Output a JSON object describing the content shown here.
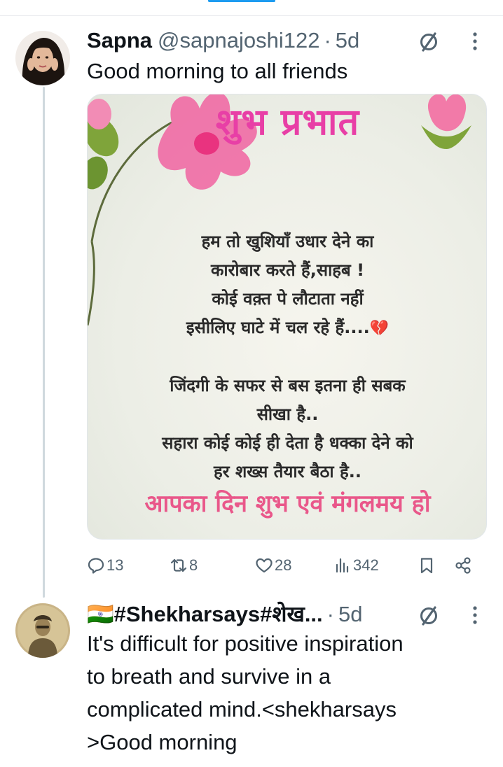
{
  "tweets": [
    {
      "display_name": "Sapna",
      "handle": "@sapnajoshi122",
      "separator": "·",
      "time": "5d",
      "text": "Good morning to all friends",
      "media": {
        "title": "शुभ प्रभात",
        "poem_stanza_1": [
          "हम तो खुशियाँ उधार देने का",
          "कारोबार करते हैं,साहब !",
          "कोई वक़्त पे लौटाता नहीं",
          "इसीलिए घाटे में चल रहे हैं...."
        ],
        "poem_stanza_2": [
          "जिंदगी के सफर से बस इतना ही सबक",
          "सीखा है..",
          "सहारा कोई कोई ही देता है धक्का देने को",
          "हर शख्स तैयार बैठा है.."
        ],
        "blessing": "आपका दिन शुभ एवं मंगलमय हो",
        "broken_heart_emoji": "💔"
      },
      "stats": {
        "replies": "13",
        "reposts": "8",
        "likes": "28",
        "views": "342"
      }
    },
    {
      "display_name": "🇮🇳#Shekharsays#शेख...",
      "separator": "·",
      "time": "5d",
      "text_lines": [
        "It's difficult for positive inspiration",
        "to breath and survive in a",
        "complicated mind.<shekharsays",
        ">Good morning"
      ]
    }
  ],
  "icons": [
    "grok-slash-icon",
    "more-vertical-icon",
    "reply-icon",
    "repost-icon",
    "like-icon",
    "views-icon",
    "bookmark-icon",
    "share-icon"
  ],
  "colors": {
    "accent": "#1d9bf0",
    "muted_text": "#536471",
    "thread_line": "#cfd9de",
    "title_pink": "#e83fa6",
    "blessing_pink": "#e9578a"
  }
}
